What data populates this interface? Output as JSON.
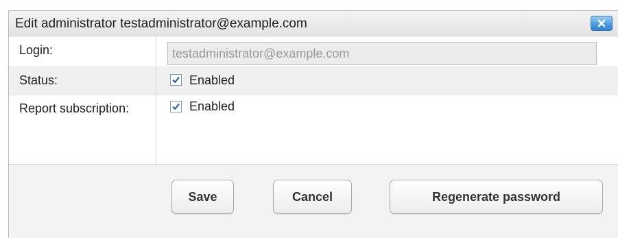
{
  "dialog": {
    "title": "Edit administrator testadministrator@example.com",
    "close_icon": "close-icon"
  },
  "form": {
    "login": {
      "label": "Login:",
      "value": "testadministrator@example.com"
    },
    "status": {
      "label": "Status:",
      "checked": true,
      "checkbox_label": "Enabled"
    },
    "report_subscription": {
      "label": "Report subscription:",
      "checked": true,
      "checkbox_label": "Enabled"
    }
  },
  "buttons": {
    "save": "Save",
    "cancel": "Cancel",
    "regenerate": "Regenerate password"
  },
  "colors": {
    "close_button": "#4a9de0",
    "checkmark": "#2d5fa8"
  }
}
